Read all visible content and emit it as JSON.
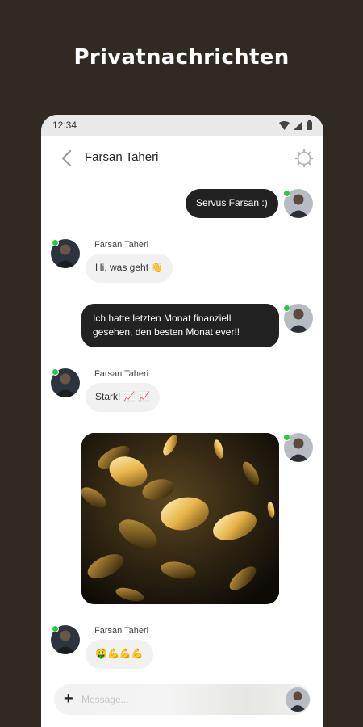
{
  "promo": {
    "title": "Privatnachrichten"
  },
  "status_bar": {
    "time": "12:34"
  },
  "header": {
    "title": "Farsan Taheri"
  },
  "messages": [
    {
      "from": "me",
      "text": "Servus Farsan :)"
    },
    {
      "from": "contact",
      "sender": "Farsan Taheri",
      "text": "Hi, was geht 👋"
    },
    {
      "from": "me",
      "text_line1": "Ich hatte letzten Monat finanziell",
      "text_line2": "gesehen, den besten Monat ever!!"
    },
    {
      "from": "contact",
      "sender": "Farsan Taheri",
      "text": "Stark! 📈 📈"
    },
    {
      "from": "me",
      "type": "image",
      "image_icon": "golden-coins-image"
    },
    {
      "from": "contact",
      "sender": "Farsan Taheri",
      "text": "🤑💪💪💪"
    }
  ],
  "composer": {
    "placeholder": "Message..."
  },
  "colors": {
    "background": "#302a22",
    "online": "#27c93f",
    "bubble_dark": "#222222",
    "bubble_light": "#f1f1f1"
  }
}
